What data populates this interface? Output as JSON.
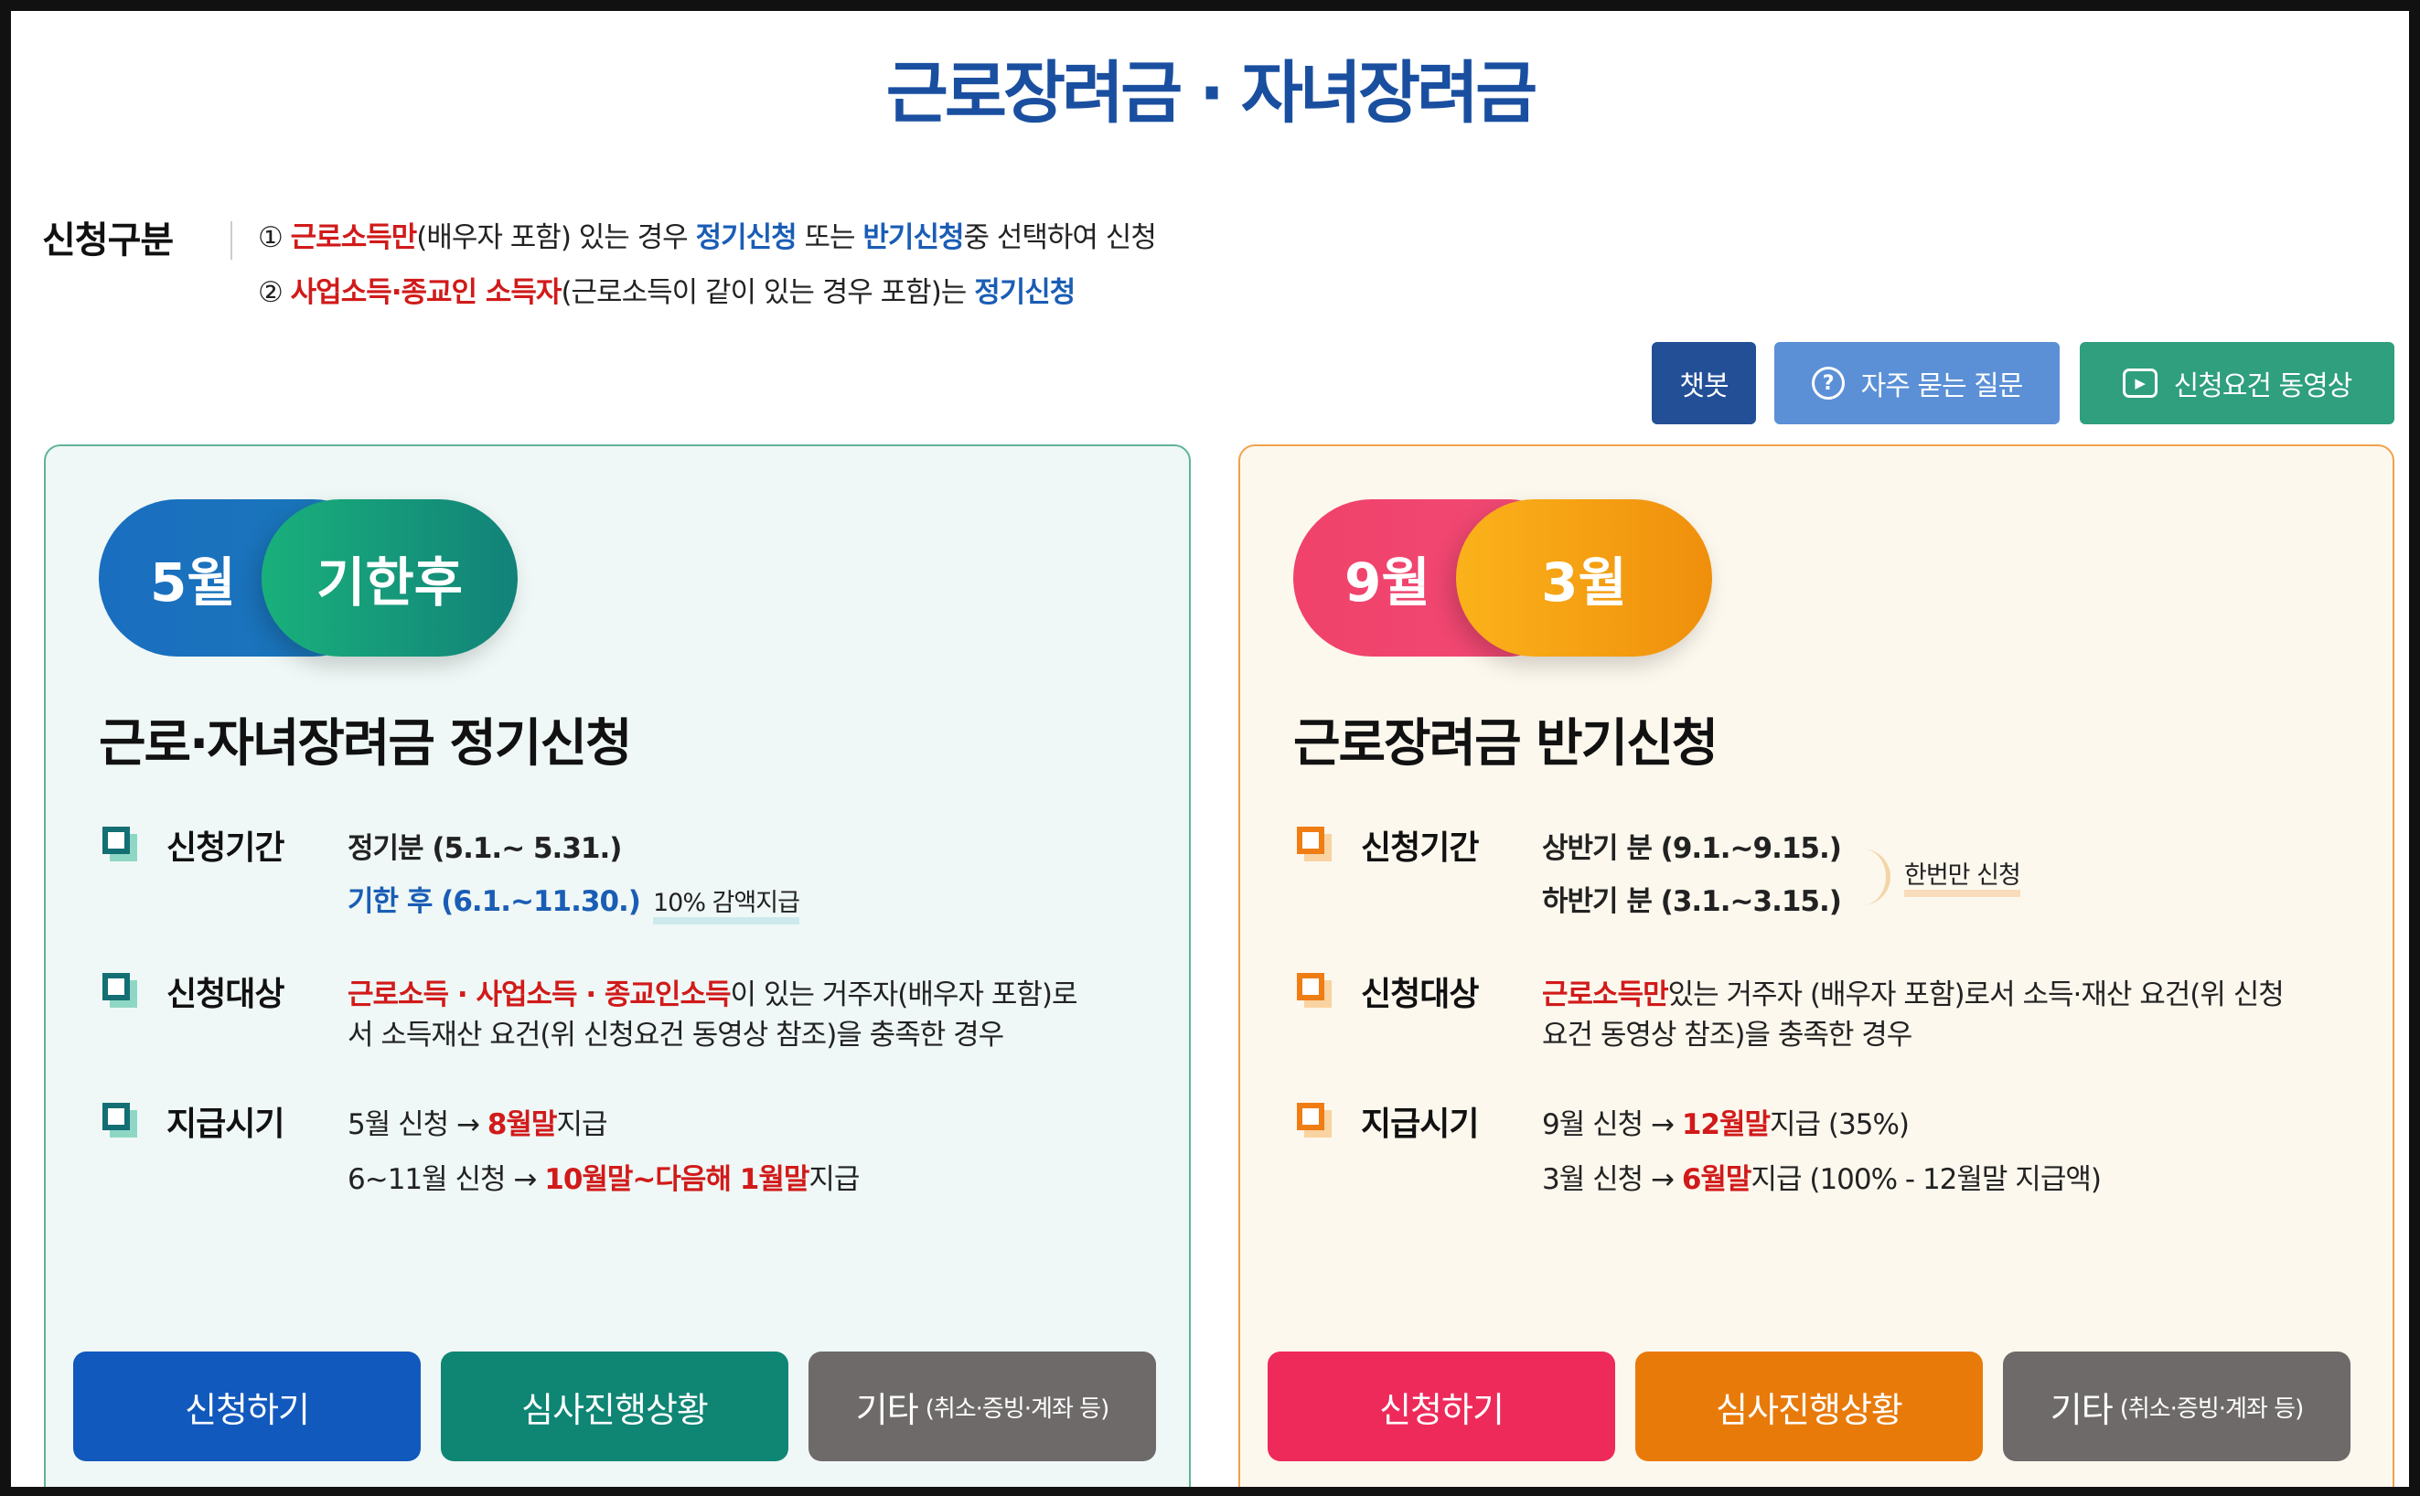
{
  "title": "근로장려금 · 자녀장려금",
  "category": {
    "label": "신청구분",
    "line1": {
      "marker": "① ",
      "red": "근로소득만",
      "t1": "(배우자 포함) 있는 경우 ",
      "blue1": "정기신청",
      "t2": " 또는 ",
      "blue2": "반기신청",
      "t3": "중 선택하여 신청"
    },
    "line2": {
      "marker": "② ",
      "red": "사업소득·종교인 소득자",
      "t1": "(근로소득이 같이 있는 경우 포함)는 ",
      "blue": "정기신청"
    }
  },
  "top_buttons": {
    "chatbot": "챗봇",
    "faq": "자주 묻는 질문",
    "video": "신청요건 동영상"
  },
  "regular": {
    "pill1": "5월",
    "pill2": "기한후",
    "title": "근로·자녀장려금 정기신청",
    "period_label": "신청기간",
    "period_1": "정기분 (5.1.~ 5.31.)",
    "period_2": "기한 후 (6.1.~11.30.)",
    "period_note": "10% 감액지급",
    "target_label": "신청대상",
    "target_red": "근로소득 · 사업소득 · 종교인소득",
    "target_t1": "이 있는 거주자(배우자 포함)로",
    "target_t2": "서 소득재산 요건(위 신청요건 동영상 참조)을 충족한 경우",
    "pay_label": "지급시기",
    "pay1_a": "5월 신청 → ",
    "pay1_red": "8월말",
    "pay1_b": "지급",
    "pay2_a": "6~11월 신청 → ",
    "pay2_red": "10월말~다음해 1월말",
    "pay2_b": "지급",
    "btn_apply": "신청하기",
    "btn_status": "심사진행상황",
    "btn_etc": "기타",
    "btn_etc_small": "(취소·증빙·계좌 등)"
  },
  "half": {
    "pill1": "9월",
    "pill2": "3월",
    "title": "근로장려금 반기신청",
    "period_label": "신청기간",
    "period_1": "상반기 분 (9.1.~9.15.)",
    "period_2": "하반기 분 (3.1.~3.15.)",
    "period_note": "한번만 신청",
    "target_label": "신청대상",
    "target_red": "근로소득만",
    "target_t1": "있는 거주자 (배우자 포함)로서 소득·재산 요건(위 신청",
    "target_t2": "요건 동영상 참조)을 충족한 경우",
    "pay_label": "지급시기",
    "pay1_a": "9월 신청 → ",
    "pay1_red": "12월말",
    "pay1_b": "지급 (35%)",
    "pay2_a": "3월 신청 → ",
    "pay2_red": "6월말",
    "pay2_b": "지급 (100% - 12월말 지급액)",
    "btn_apply": "신청하기",
    "btn_status": "심사진행상황",
    "btn_etc": "기타",
    "btn_etc_small": "(취소·증빙·계좌 등)"
  }
}
